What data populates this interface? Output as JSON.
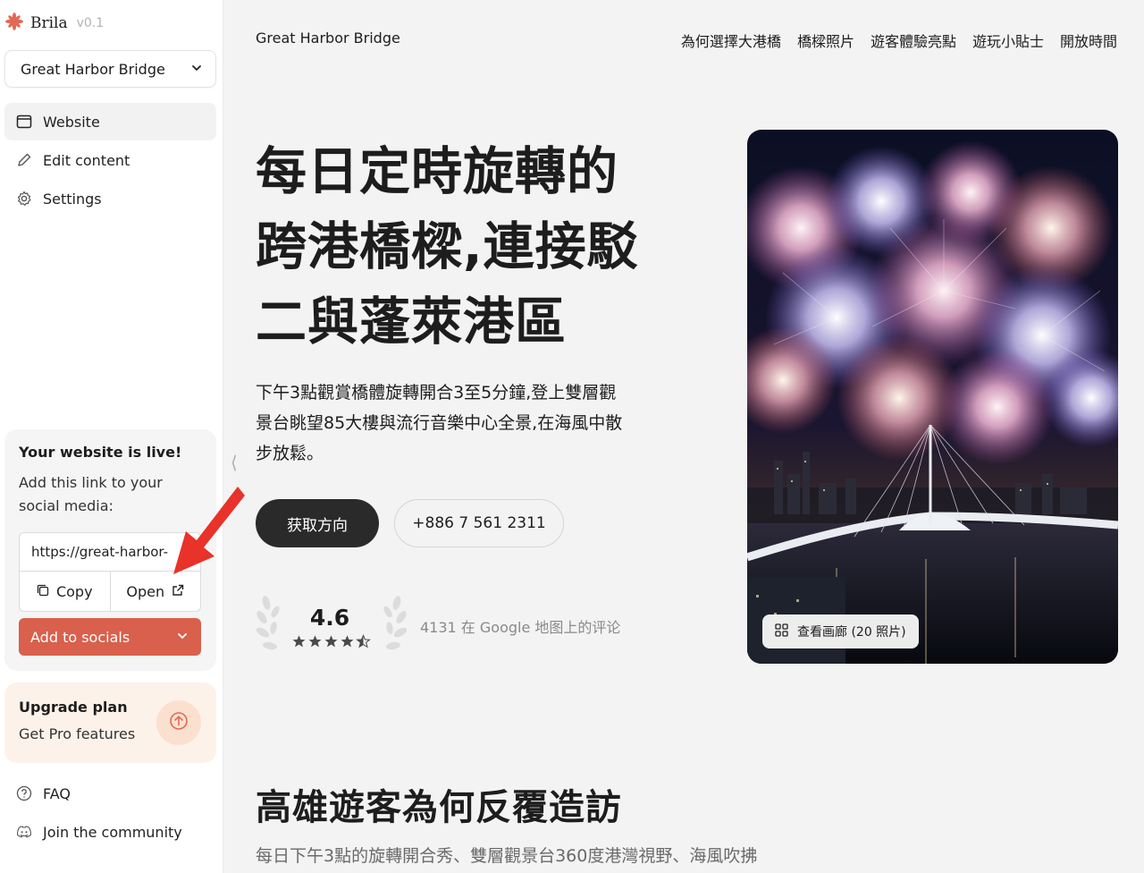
{
  "brand": {
    "name": "Brila",
    "version": "v0.1",
    "accent_color": "#e06a56"
  },
  "site_selector": {
    "selected": "Great Harbor Bridge"
  },
  "sidebar": {
    "items": [
      {
        "label": "Website",
        "icon": "browser-window-icon",
        "active": true
      },
      {
        "label": "Edit content",
        "icon": "pencil-icon",
        "active": false
      },
      {
        "label": "Settings",
        "icon": "gear-icon",
        "active": false
      }
    ],
    "live_card": {
      "title": "Your website is live!",
      "subtitle": "Add this link to your social media:",
      "url": "https://great-harbor-",
      "copy_label": "Copy",
      "open_label": "Open",
      "add_to_socials_label": "Add to socials"
    },
    "upgrade": {
      "title": "Upgrade plan",
      "subtitle": "Get Pro features"
    },
    "bottom_items": [
      {
        "label": "FAQ",
        "icon": "question-circle-icon"
      },
      {
        "label": "Join the community",
        "icon": "discord-icon"
      }
    ]
  },
  "site": {
    "title": "Great Harbor Bridge",
    "nav": [
      "為何選擇大港橋",
      "橋樑照片",
      "遊客體驗亮點",
      "遊玩小貼士",
      "開放時間"
    ],
    "hero": {
      "headline": "每日定時旋轉的跨港橋樑,連接駁二與蓬萊港區",
      "description": "下午3點觀賞橋體旋轉開合3至5分鐘,登上雙層觀景台眺望85大樓與流行音樂中心全景,在海風中散步放鬆。",
      "primary_button": "获取方向",
      "phone_button": "+886 7 561 2311",
      "rating": "4.6",
      "stars": 4.5,
      "reviews_text": "4131 在 Google 地图上的评论",
      "gallery_button": "查看画廊 (20 照片)"
    },
    "section": {
      "title": "高雄遊客為何反覆造訪",
      "subtitle": "每日下午3點的旋轉開合秀、雙層觀景台360度港灣視野、海風吹拂"
    }
  }
}
